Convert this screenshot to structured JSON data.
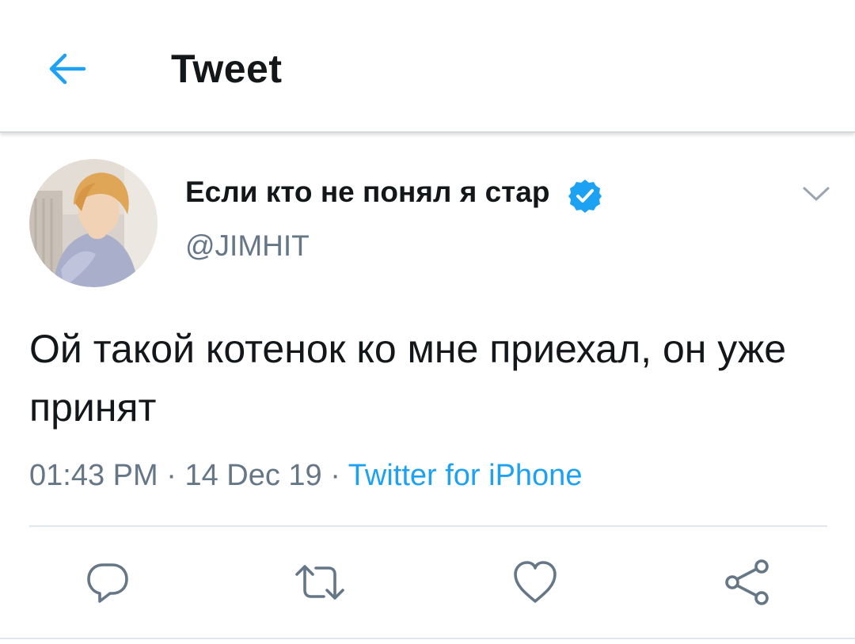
{
  "header": {
    "title": "Tweet",
    "back_icon": "arrow-left-icon"
  },
  "colors": {
    "accent": "#1da1f2",
    "text": "#14171a",
    "secondary": "#657786"
  },
  "tweet": {
    "author_name": "Если кто не понял я стар",
    "author_handle": "@JIMHIT",
    "verified": true,
    "text": "Ой такой котенок ко мне приехал, он уже принят",
    "time": "01:43 PM",
    "date": "14 Dec 19",
    "separator": " · ",
    "source": "Twitter for iPhone"
  },
  "actions": [
    {
      "name": "reply",
      "icon": "reply-icon"
    },
    {
      "name": "retweet",
      "icon": "retweet-icon"
    },
    {
      "name": "like",
      "icon": "heart-icon"
    },
    {
      "name": "share",
      "icon": "share-icon"
    }
  ]
}
